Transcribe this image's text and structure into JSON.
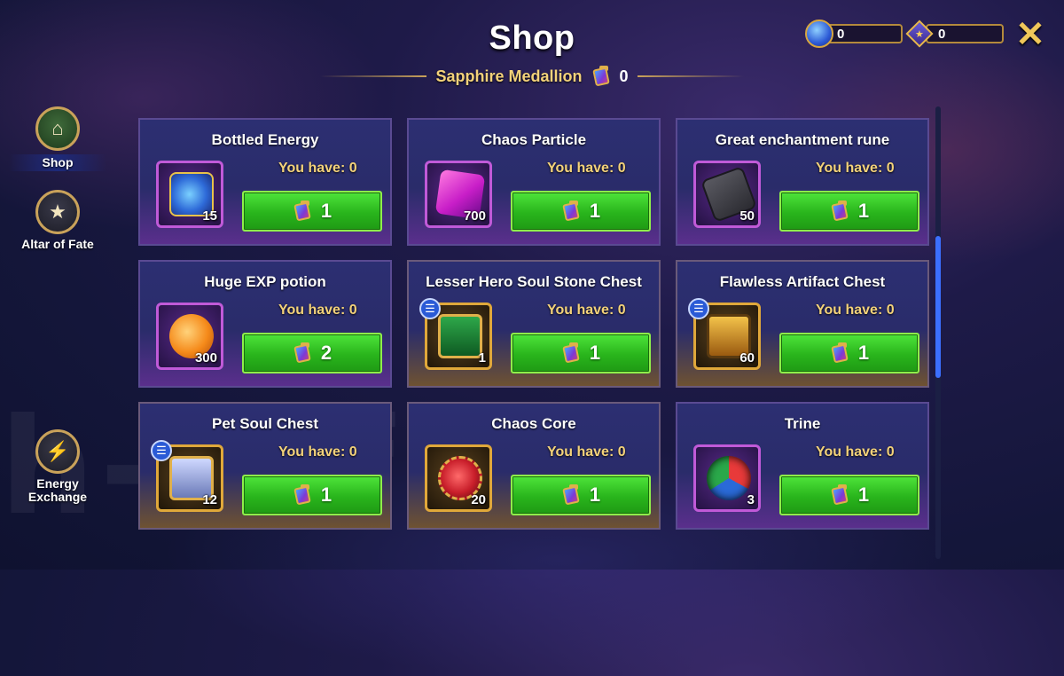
{
  "header": {
    "title": "Shop",
    "subtitle": "Sapphire Medallion",
    "subtitle_count": "0"
  },
  "currencies": [
    {
      "icon": "gem-icon",
      "value": "0"
    },
    {
      "icon": "emblem-icon",
      "value": "0"
    }
  ],
  "sidebar": {
    "items": [
      {
        "label": "Shop",
        "icon": "shop-icon",
        "active": true
      },
      {
        "label": "Altar of Fate",
        "icon": "star-icon"
      },
      {
        "label": "Energy Exchange",
        "icon": "energy-swap-icon"
      }
    ]
  },
  "shop": {
    "items": [
      {
        "name": "Bottled Energy",
        "you_have": "You have: 0",
        "qty": "15",
        "price": "1",
        "rarity_color": "#c05ad8"
      },
      {
        "name": "Chaos Particle",
        "you_have": "You have: 0",
        "qty": "700",
        "price": "1",
        "rarity_color": "#c05ad8"
      },
      {
        "name": "Great enchantment rune",
        "you_have": "You have: 0",
        "qty": "50",
        "price": "1",
        "rarity_color": "#c05ad8"
      },
      {
        "name": "Huge EXP potion",
        "you_have": "You have: 0",
        "qty": "300",
        "price": "2",
        "rarity_color": "#c05ad8"
      },
      {
        "name": "Lesser Hero Soul Stone Chest",
        "you_have": "You have: 0",
        "qty": "1",
        "price": "1",
        "rarity_color": "#e0a83a"
      },
      {
        "name": "Flawless Artifact Chest",
        "you_have": "You have: 0",
        "qty": "60",
        "price": "1",
        "rarity_color": "#e0a83a"
      },
      {
        "name": "Pet Soul Chest",
        "you_have": "You have: 0",
        "qty": "12",
        "price": "1",
        "rarity_color": "#e0a83a"
      },
      {
        "name": "Chaos Core",
        "you_have": "You have: 0",
        "qty": "20",
        "price": "1",
        "rarity_color": "#e0a83a"
      },
      {
        "name": "Trine",
        "you_have": "You have: 0",
        "qty": "3",
        "price": "1",
        "rarity_color": "#c05ad8"
      }
    ]
  }
}
